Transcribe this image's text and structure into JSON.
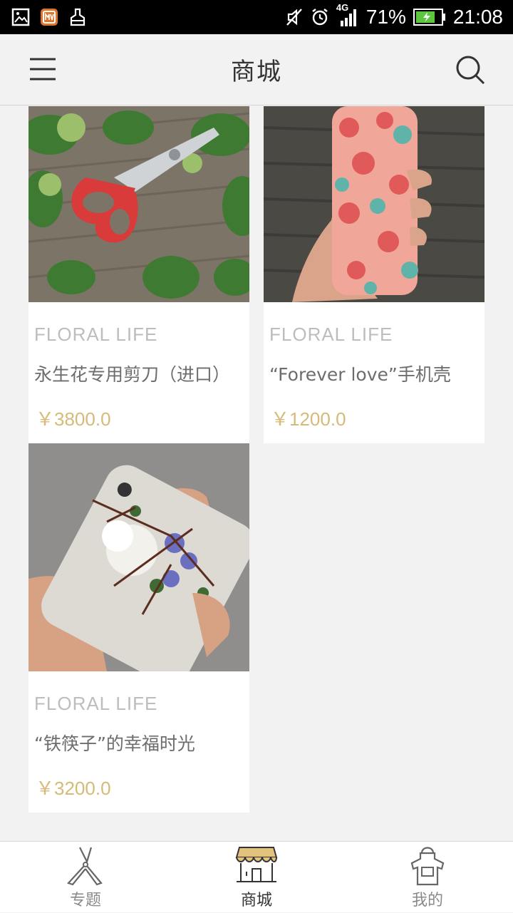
{
  "status_bar": {
    "network": "4G",
    "battery": "71%",
    "time": "21:08"
  },
  "header": {
    "title": "商城",
    "menu_icon": "menu-icon",
    "search_icon": "search-icon"
  },
  "products": [
    {
      "brand": "FLORAL LIFE",
      "name": "永生花专用剪刀（进口）",
      "price": "￥3800.0",
      "image": "red-scissors-with-leaves"
    },
    {
      "brand": "FLORAL LIFE",
      "name": "“Forever love”手机壳",
      "price": "￥1200.0",
      "image": "floral-phone-case-in-hand"
    },
    {
      "brand": "FLORAL LIFE",
      "name": "“铁筷子”的幸福时光",
      "price": "￥3200.0",
      "image": "white-flower-phone-case-in-hand"
    }
  ],
  "tabs": [
    {
      "label": "专题",
      "icon": "pruning-shears-icon"
    },
    {
      "label": "商城",
      "icon": "shop-awning-icon",
      "active": true
    },
    {
      "label": "我的",
      "icon": "apron-icon"
    }
  ],
  "colors": {
    "price": "#d6bb78",
    "brand_text": "#bdbdbd",
    "awning": "#e2c27c"
  }
}
